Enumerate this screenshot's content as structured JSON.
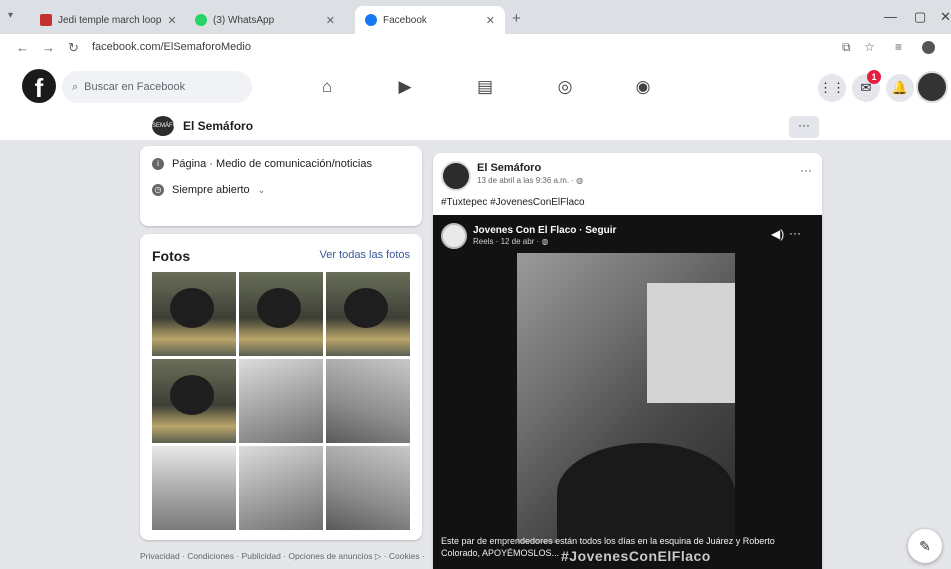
{
  "browser": {
    "tabs": [
      {
        "title": "Jedi temple march loop",
        "color": "#c4302b",
        "active": false
      },
      {
        "title": "(3) WhatsApp",
        "color": "#25d366",
        "active": false
      },
      {
        "title": "Facebook",
        "color": "#1877f2",
        "active": true
      }
    ],
    "url": "facebook.com/ElSemaforoMedio"
  },
  "fb": {
    "logo": "f",
    "search_placeholder": "Buscar en Facebook",
    "notification_count": "1"
  },
  "page": {
    "name": "El Semáforo",
    "logo_text": "SEMÁFORO"
  },
  "intro": {
    "category": "Página · Medio de comunicación/noticias",
    "hours": "Siempre abierto"
  },
  "photos": {
    "title": "Fotos",
    "see_all": "Ver todas las fotos",
    "items": [
      {
        "kind": "poster"
      },
      {
        "kind": "poster"
      },
      {
        "kind": "poster"
      },
      {
        "kind": "poster"
      },
      {
        "kind": "people1"
      },
      {
        "kind": "people2"
      },
      {
        "kind": "street"
      },
      {
        "kind": "people1"
      },
      {
        "kind": "people2"
      }
    ]
  },
  "footer": {
    "text": "Privacidad · Condiciones · Publicidad · Opciones de anuncios ▷ · Cookies ·"
  },
  "post": {
    "author": "El Semáforo",
    "time": "13 de abril a las 9:36 a.m. · ",
    "tags": "#Tuxtepec #JovenesConElFlaco",
    "more": "···",
    "video": {
      "author": "Jovenes Con El Flaco · Seguir",
      "time": "Reels · 12 de abr · ",
      "caption": "Este par de emprendedores están todos los días en la esquina de Juárez y Roberto Colorado, APOYÉMOSLOS...",
      "hashtag": "#JovenesConElFlaco"
    }
  },
  "colors": {
    "accent": "#1877f2",
    "notification": "#e41e3f"
  }
}
